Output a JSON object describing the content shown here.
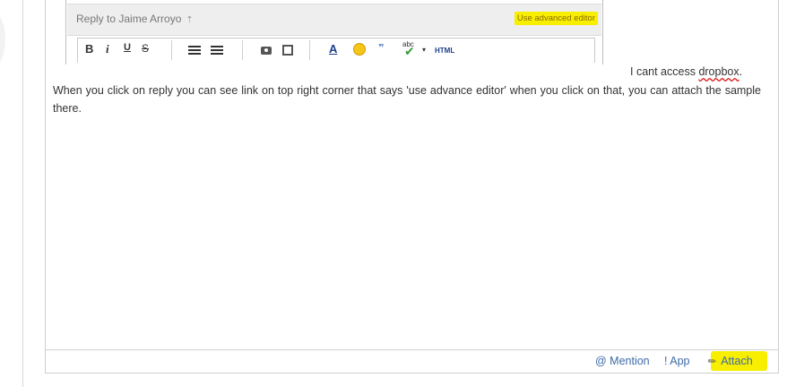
{
  "snippet": {
    "reply_to": "Reply to Jaime Arroyo",
    "reply_icon": "reply-arrow-icon",
    "advanced_editor": "Use advanced editor",
    "toolbar": {
      "bold": "B",
      "italic": "i",
      "underline": "U",
      "strike": "S",
      "font": "A",
      "spell": "abc",
      "html": "HTML"
    }
  },
  "message": {
    "line1_prefix": "I cant access ",
    "line1_word": "dropbox",
    "line1_suffix": ".",
    "body": "When you click on reply you can see link on top right corner that says 'use advance editor' when you click on that, you can attach the sample there."
  },
  "footer": {
    "mention": "@ Mention",
    "app": "! App",
    "attach": "Attach"
  },
  "colors": {
    "highlight": "#f7ee00",
    "link": "#3c6aa8"
  }
}
